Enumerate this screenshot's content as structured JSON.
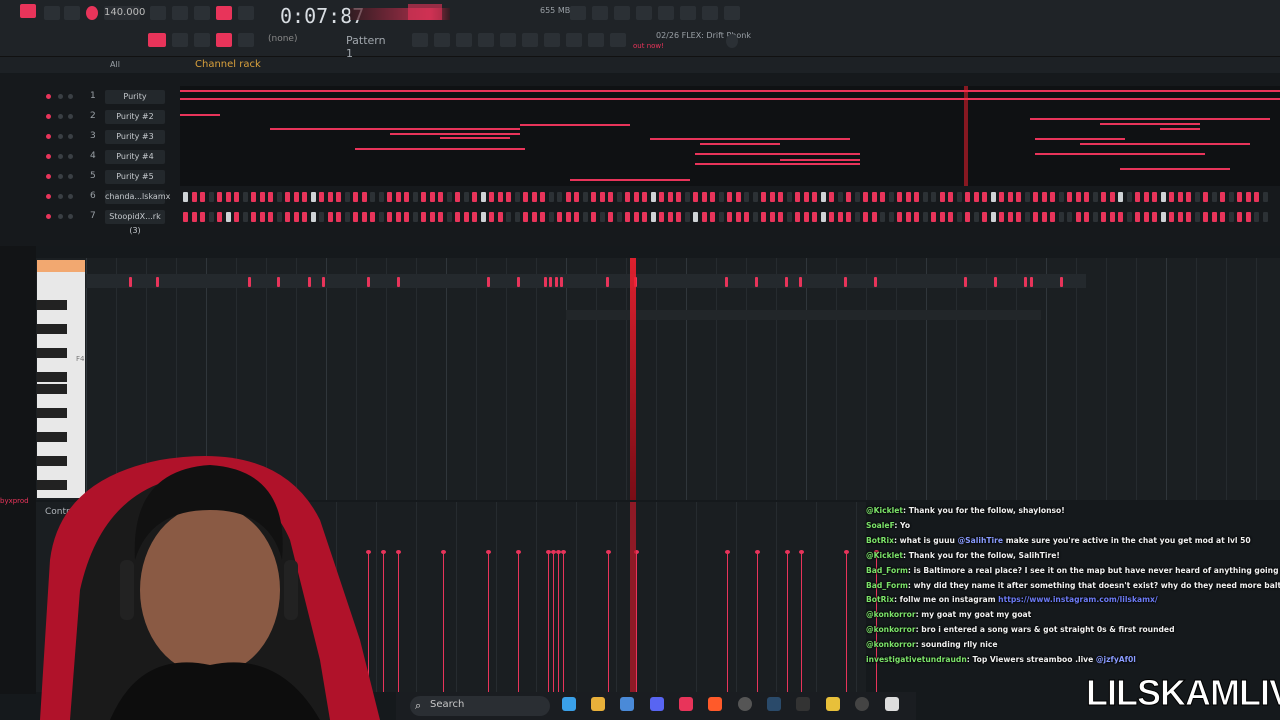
{
  "toolbar": {
    "bpm": "140.000",
    "time": "0:07:87",
    "pattern": "Pattern 1",
    "snap": "(none)",
    "memory": "655 MB",
    "hint_title": "02/26  FLEX: Drift Phonk",
    "hint_sub": "out now!"
  },
  "rack": {
    "filter": "All",
    "title": "Channel rack",
    "channels": [
      {
        "num": "1",
        "name": "Purity"
      },
      {
        "num": "2",
        "name": "Purity #2"
      },
      {
        "num": "3",
        "name": "Purity #3"
      },
      {
        "num": "4",
        "name": "Purity #4"
      },
      {
        "num": "5",
        "name": "Purity #5"
      },
      {
        "num": "6",
        "name": "chanda...lskamx"
      },
      {
        "num": "7",
        "name": "StoopidX...rk (3)"
      }
    ]
  },
  "piano_roll": {
    "key_label": "F4"
  },
  "control": {
    "label": "Control"
  },
  "side": {
    "prod_text": "byxprod"
  },
  "chat": {
    "messages": [
      {
        "user": "@Kicklet",
        "text": ": Thank you for the follow, shaylonso!"
      },
      {
        "user": "SoaleF",
        "text": ": Yo"
      },
      {
        "user": "BotRix",
        "text": ": what is guuu ",
        "mention": "@SalihTire",
        "rest": " make sure you're active in the chat you get mod at lvl 50"
      },
      {
        "user": "@Kicklet",
        "text": ": Thank you for the follow, SalihTire!"
      },
      {
        "user": "Bad_Form",
        "text": ": is Baltimore a real place? I see it on the map but have never heard of anything going on there"
      },
      {
        "user": "Bad_Form",
        "text": ": why did they name it after something that doesn't exist? why do they need more balti?"
      },
      {
        "user": "BotRix",
        "text": ": follw me on instagram ",
        "link": "https://www.instagram.com/lilskamx/"
      },
      {
        "user": "@konkorror",
        "text": ": my goat my goat my goat"
      },
      {
        "user": "@konkorror",
        "text": ": bro i entered a song wars & got straight 0s & first rounded"
      },
      {
        "user": "@konkorror",
        "text": ": sounding rlly nice"
      },
      {
        "user": "investigativetundraudn",
        "text": ": Top Viewers streamboo .live ",
        "mention": "@jzfyAf0l"
      }
    ]
  },
  "taskbar": {
    "search_label": "Search"
  },
  "brand": {
    "text": "LILSKAMLIVE"
  },
  "colors": {
    "accent": "#e8345a",
    "bg": "#15191c"
  }
}
